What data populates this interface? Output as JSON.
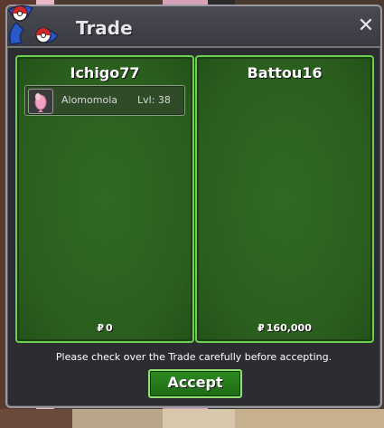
{
  "window": {
    "title": "Trade",
    "close_glyph": "✕"
  },
  "left_panel": {
    "player": "Ichigo77",
    "items": [
      {
        "icon": "pink-pokemon-icon",
        "name": "Alomomola",
        "level": "Lvl: 38"
      }
    ],
    "currency_symbol": "₽",
    "money": "0"
  },
  "right_panel": {
    "player": "Battou16",
    "currency_symbol": "₽",
    "money": "160,000"
  },
  "footer": {
    "notice": "Please check over the Trade carefully before accepting.",
    "accept_label": "Accept"
  },
  "colors": {
    "panel_green": "#2e6a22",
    "panel_border": "#6bd04a",
    "window_bg": "#2c2c33",
    "accept_green": "#2d8a1f"
  }
}
